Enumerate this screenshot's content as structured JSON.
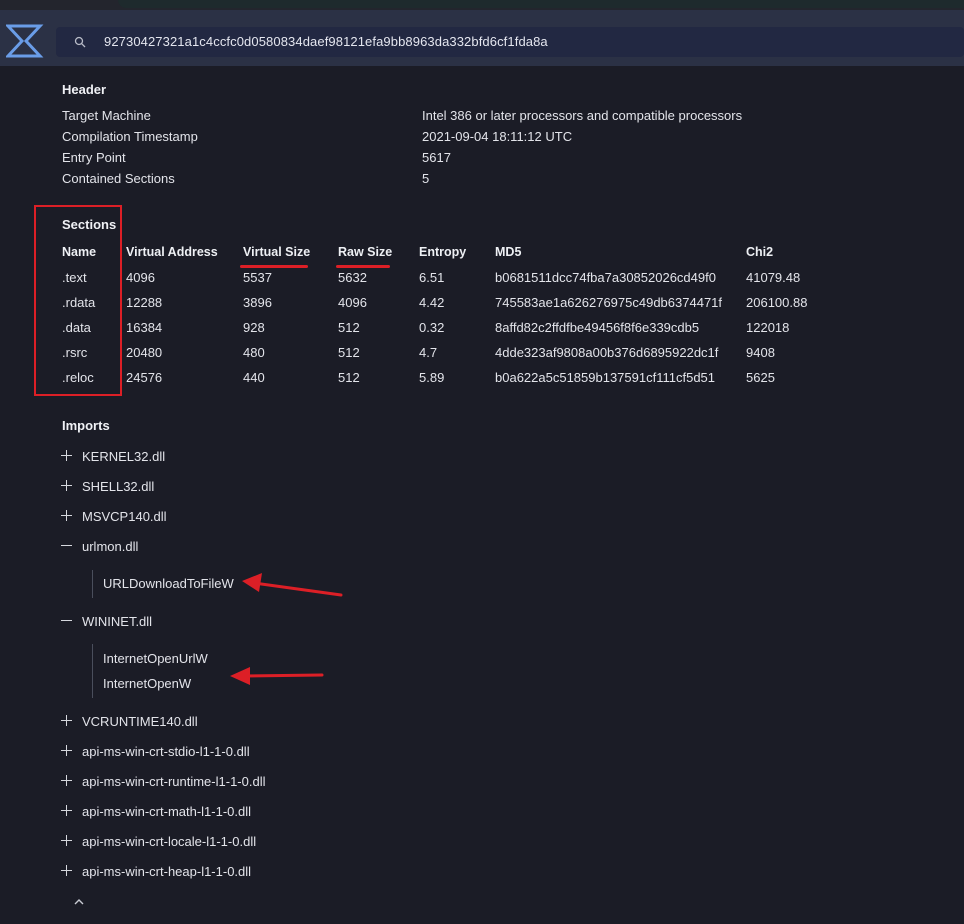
{
  "search": {
    "query": "92730427321a1c4ccfc0d0580834daef98121efa9bb8963da332bfd6cf1fda8a"
  },
  "header": {
    "title": "Header",
    "rows": [
      {
        "label": "Target Machine",
        "value": "Intel 386 or later processors and compatible processors"
      },
      {
        "label": "Compilation Timestamp",
        "value": "2021-09-04 18:11:12 UTC"
      },
      {
        "label": "Entry Point",
        "value": "5617"
      },
      {
        "label": "Contained Sections",
        "value": "5"
      }
    ]
  },
  "sections": {
    "title": "Sections",
    "columns": [
      "Name",
      "Virtual Address",
      "Virtual Size",
      "Raw Size",
      "Entropy",
      "MD5",
      "Chi2"
    ],
    "rows": [
      [
        ".text",
        "4096",
        "5537",
        "5632",
        "6.51",
        "b0681511dcc74fba7a30852026cd49f0",
        "41079.48"
      ],
      [
        ".rdata",
        "12288",
        "3896",
        "4096",
        "4.42",
        "745583ae1a626276975c49db6374471f",
        "206100.88"
      ],
      [
        ".data",
        "16384",
        "928",
        "512",
        "0.32",
        "8affd82c2ffdfbe49456f8f6e339cdb5",
        "122018"
      ],
      [
        ".rsrc",
        "20480",
        "480",
        "512",
        "4.7",
        "4dde323af9808a00b376d6895922dc1f",
        "9408"
      ],
      [
        ".reloc",
        "24576",
        "440",
        "512",
        "5.89",
        "b0a622a5c51859b137591cf111cf5d51",
        "5625"
      ]
    ]
  },
  "imports": {
    "title": "Imports",
    "dlls": [
      {
        "name": "KERNEL32.dll",
        "expanded": false
      },
      {
        "name": "SHELL32.dll",
        "expanded": false
      },
      {
        "name": "MSVCP140.dll",
        "expanded": false
      },
      {
        "name": "urlmon.dll",
        "expanded": true,
        "functions": [
          "URLDownloadToFileW"
        ]
      },
      {
        "name": "WININET.dll",
        "expanded": true,
        "functions": [
          "InternetOpenUrlW",
          "InternetOpenW"
        ]
      },
      {
        "name": "VCRUNTIME140.dll",
        "expanded": false
      },
      {
        "name": "api-ms-win-crt-stdio-l1-1-0.dll",
        "expanded": false
      },
      {
        "name": "api-ms-win-crt-runtime-l1-1-0.dll",
        "expanded": false
      },
      {
        "name": "api-ms-win-crt-math-l1-1-0.dll",
        "expanded": false
      },
      {
        "name": "api-ms-win-crt-locale-l1-1-0.dll",
        "expanded": false
      },
      {
        "name": "api-ms-win-crt-heap-l1-1-0.dll",
        "expanded": false
      }
    ]
  },
  "colors": {
    "accent": "#6a9de8",
    "annotation": "#dc1f26",
    "background": "#1b1c26",
    "topbar": "#2b3145"
  },
  "icons": {
    "logo": "sigma-logo-icon",
    "search": "search-icon",
    "expand": "plus-icon",
    "collapse": "minus-icon",
    "scroll_top": "chevron-up-icon"
  }
}
